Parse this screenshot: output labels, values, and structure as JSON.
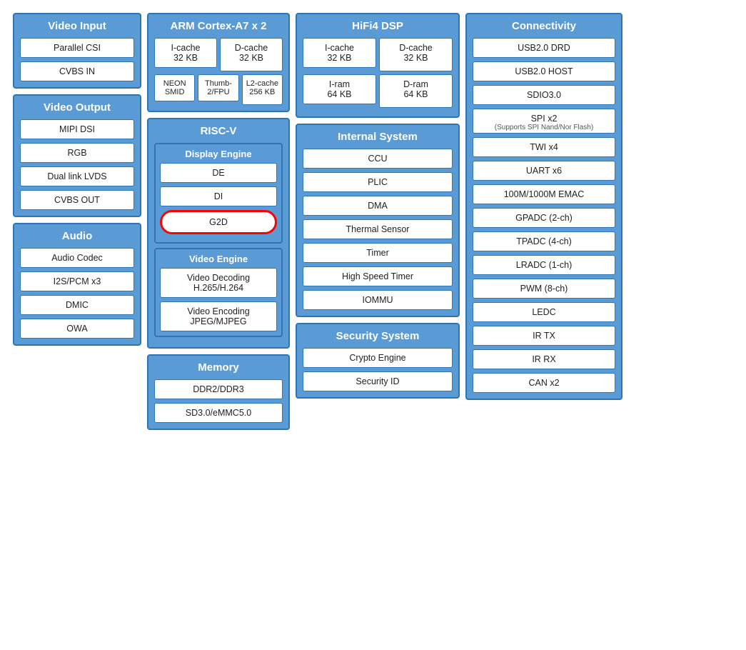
{
  "videoInput": {
    "title": "Video Input",
    "items": [
      "Parallel CSI",
      "CVBS IN"
    ]
  },
  "videoOutput": {
    "title": "Video Output",
    "items": [
      "MIPI DSI",
      "RGB",
      "Dual link LVDS",
      "CVBS OUT"
    ]
  },
  "audio": {
    "title": "Audio",
    "items": [
      "Audio Codec",
      "I2S/PCM x3",
      "DMIC",
      "OWA"
    ]
  },
  "armCortex": {
    "title": "ARM Cortex-A7 x 2",
    "icache": "I-cache\n32 KB",
    "dcache": "D-cache\n32 KB",
    "neon": "NEON\nSMID",
    "thumb": "Thumb-\n2/FPU",
    "l2cache": "L2-cache\n256 KB"
  },
  "riscv": {
    "title": "RISC-V"
  },
  "displayEngine": {
    "title": "Display Engine",
    "items": [
      "DE",
      "DI",
      "G2D"
    ]
  },
  "videoEngine": {
    "title": "Video Engine",
    "items": [
      "Video Decoding\nH.265/H.264",
      "Video Encoding\nJPEG/MJPEG"
    ]
  },
  "memory": {
    "title": "Memory",
    "items": [
      "DDR2/DDR3",
      "SD3.0/eMMC5.0"
    ]
  },
  "hifi4": {
    "title": "HiFi4 DSP",
    "icache": "I-cache\n32 KB",
    "dcache": "D-cache\n32 KB",
    "iram": "I-ram\n64 KB",
    "dram": "D-ram\n64 KB"
  },
  "internalSystem": {
    "title": "Internal System",
    "items": [
      "CCU",
      "PLIC",
      "DMA",
      "Thermal Sensor",
      "Timer",
      "High Speed Timer",
      "IOMMU"
    ]
  },
  "securitySystem": {
    "title": "Security System",
    "items": [
      "Crypto Engine",
      "Security ID"
    ]
  },
  "connectivity": {
    "title": "Connectivity",
    "items": [
      "USB2.0 DRD",
      "USB2.0 HOST",
      "SDIO3.0",
      "SPI x2",
      "(Supports SPI Nand/Nor Flash)",
      "TWI x4",
      "UART x6",
      "100M/1000M EMAC",
      "GPADC (2-ch)",
      "TPADC (4-ch)",
      "LRADC (1-ch)",
      "PWM (8-ch)",
      "LEDC",
      "IR TX",
      "IR RX",
      "CAN x2"
    ]
  }
}
